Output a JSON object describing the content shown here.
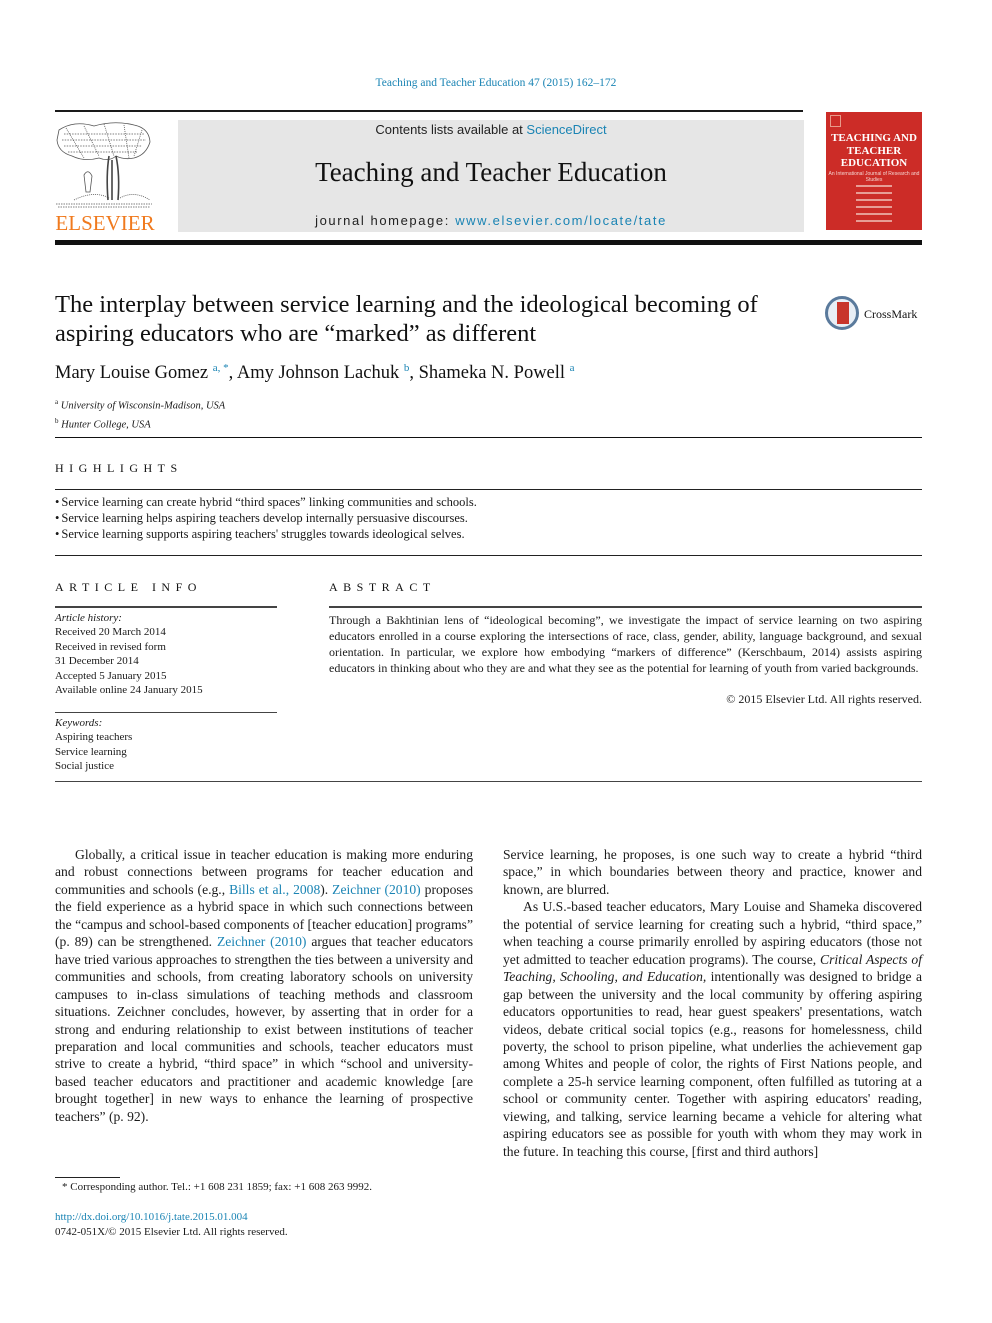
{
  "running_head": "Teaching and Teacher Education 47 (2015) 162–172",
  "masthead": {
    "contents_prefix": "Contents lists available at ",
    "contents_link": "ScienceDirect",
    "journal_name": "Teaching and Teacher Education",
    "homepage_prefix": "journal homepage: ",
    "homepage_link": "www.elsevier.com/locate/tate",
    "publisher_logo_text": "ELSEVIER",
    "cover_title": "TEACHING AND TEACHER EDUCATION",
    "cover_subtitle": "An International Journal of Research and Studies",
    "colors": {
      "publisher_orange": "#f07a1e",
      "cover_red": "#cc2c27",
      "link_blue": "#1a84b4",
      "masthead_gray": "#e6e6e6"
    }
  },
  "article": {
    "title": "The interplay between service learning and the ideological becoming of aspiring educators who are “marked” as different",
    "crossmark_label": "CrossMark",
    "authors": [
      {
        "name": "Mary Louise Gomez",
        "sup": "a, *"
      },
      {
        "name": "Amy Johnson Lachuk",
        "sup": "b"
      },
      {
        "name": "Shameka N. Powell",
        "sup": "a"
      }
    ],
    "affiliations": [
      {
        "key": "a",
        "text": "University of Wisconsin-Madison, USA"
      },
      {
        "key": "b",
        "text": "Hunter College, USA"
      }
    ]
  },
  "highlights": {
    "heading": "HIGHLIGHTS",
    "items": [
      "Service learning can create hybrid “third spaces” linking communities and schools.",
      "Service learning helps aspiring teachers develop internally persuasive discourses.",
      "Service learning supports aspiring teachers' struggles towards ideological selves."
    ]
  },
  "article_info": {
    "heading": "ARTICLE INFO",
    "history_label": "Article history:",
    "history": [
      "Received 20 March 2014",
      "Received in revised form",
      "31 December 2014",
      "Accepted 5 January 2015",
      "Available online 24 January 2015"
    ],
    "keywords_label": "Keywords:",
    "keywords": [
      "Aspiring teachers",
      "Service learning",
      "Social justice"
    ]
  },
  "abstract": {
    "heading": "ABSTRACT",
    "text": "Through a Bakhtinian lens of “ideological becoming”, we investigate the impact of service learning on two aspiring educators enrolled in a course exploring the intersections of race, class, gender, ability, language background, and sexual orientation. In particular, we explore how embodying “markers of difference” (Kerschbaum, 2014) assists aspiring educators in thinking about who they are and what they see as the potential for learning of youth from varied backgrounds.",
    "copyright": "© 2015 Elsevier Ltd. All rights reserved."
  },
  "body": {
    "left": {
      "p1_a": "Globally, a critical issue in teacher education is making more enduring and robust connections between programs for teacher education and communities and schools (e.g., ",
      "p1_link1": "Bills et al., 2008",
      "p1_b": "). ",
      "p1_link2": "Zeichner (2010)",
      "p1_c": " proposes the field experience as a hybrid space in which such connections between the “campus and school-based components of [teacher education] programs” (p. 89) can be strengthened. ",
      "p1_link3": "Zeichner (2010)",
      "p1_d": " argues that teacher educators have tried various approaches to strengthen the ties between a univer­sity and communities and schools, from creating laboratory schools on university campuses to in-class simulations of teaching methods and classroom situations. Zeichner concludes, however, by assert­ing that in order for a strong and enduring relationship to exist between institutions of teacher preparation and local communities and schools, teacher educators must strive to create a hybrid, “third space” in which “school and university-based teacher educators and practitioner and academic knowledge [are brought together] in new ways to enhance the learning of prospective teachers” (p. 92)."
    },
    "right": {
      "p1": "Service learning, he proposes, is one such way to create a hybrid “third space,” in which boundaries between theory and practice, knower and known, are blurred.",
      "p2_a": "As U.S.-based teacher educators, Mary Louise and Shameka discovered the potential of service learning for creating such a hybrid, “third space,” when teaching a course primarily enrolled by aspiring educators (those not yet admitted to teacher education programs). The course, ",
      "p2_course": "Critical Aspects of Teaching, Schooling, and Education,",
      "p2_b": " intentionally was designed to bridge a gap between the university and the local community by offering aspiring educators opportunities to read, hear guest speakers' presentations, watch videos, debate critical social topics (e.g., reasons for homelessness, child poverty, the school to prison pipeline, what underlies the achievement gap among Whites and people of color, the rights of First Nations people, and complete a 25-h service learning component, often fulfilled as tutoring at a school or community center. Together with aspiring educators' reading, viewing, and talking, service learning became a vehicle for altering what aspiring educators see as possible for youth with whom they may work in the future. In teaching this course, [first and third authors]"
    }
  },
  "footnote": "* Corresponding author. Tel.: +1 608 231 1859; fax: +1 608 263 9992.",
  "doi": "http://dx.doi.org/10.1016/j.tate.2015.01.004",
  "issn_line": "0742-051X/© 2015 Elsevier Ltd. All rights reserved."
}
